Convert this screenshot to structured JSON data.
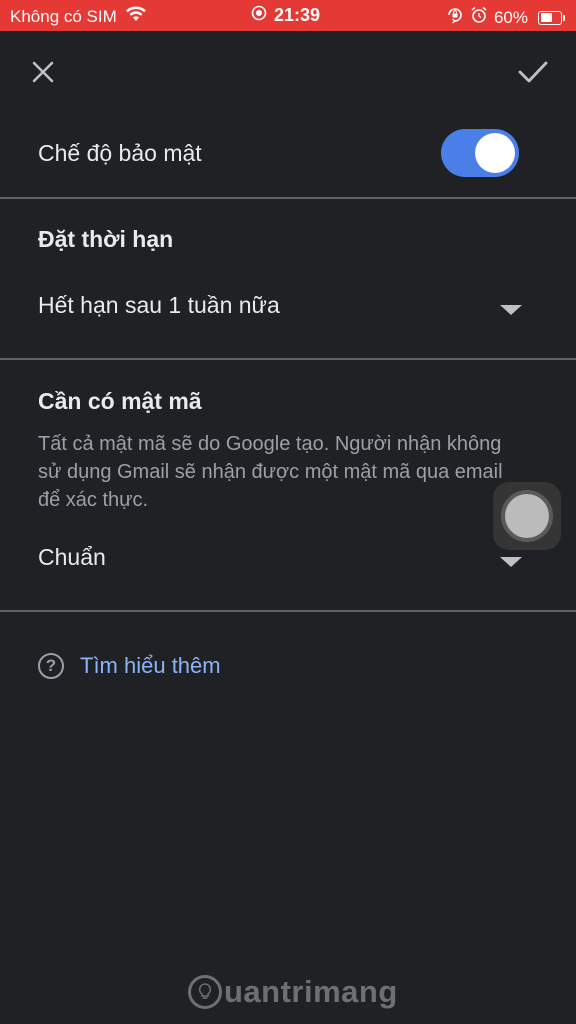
{
  "status_bar": {
    "carrier": "Không có SIM",
    "time": "21:39",
    "battery_percent": "60%",
    "battery_level": 0.6,
    "background_color": "#e53935"
  },
  "top_bar": {
    "close_icon": "close-icon",
    "confirm_icon": "check-icon"
  },
  "confidential": {
    "label": "Chế độ bảo mật",
    "enabled": true,
    "toggle_color": "#4a7fe8"
  },
  "expiration": {
    "title": "Đặt thời hạn",
    "selected": "Hết hạn sau 1 tuần nữa"
  },
  "passcode": {
    "title": "Cần có mật mã",
    "description": "Tất cả mật mã sẽ do Google tạo. Người nhận không sử dụng Gmail sẽ nhận được một mật mã qua email để xác thực.",
    "selected": "Chuẩn"
  },
  "learn_more": {
    "label": "Tìm hiểu thêm",
    "icon": "help-icon",
    "link_color": "#8ab4f8"
  },
  "watermark": {
    "text": "uantrimang"
  }
}
